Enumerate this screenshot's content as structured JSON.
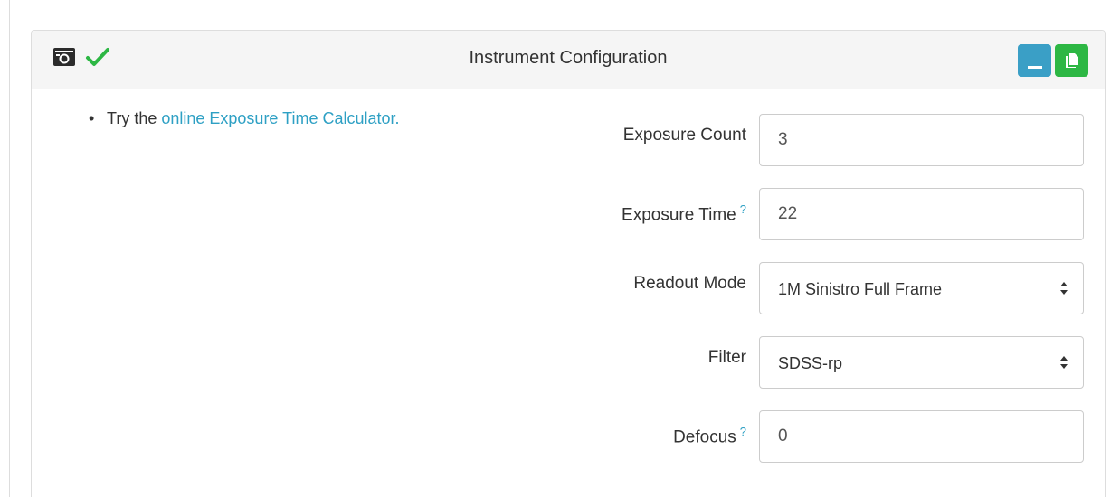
{
  "panel": {
    "title": "Instrument Configuration",
    "icons": [
      "camera-icon",
      "checkmark-icon"
    ],
    "buttons": [
      {
        "name": "minimize",
        "icon": "minimize-icon",
        "color": "#3a9fc6"
      },
      {
        "name": "copy",
        "icon": "copy-icon",
        "color": "#2db744"
      }
    ]
  },
  "tip": {
    "bullet": "•",
    "prefix": "Try the ",
    "link_text": "online Exposure Time Calculator."
  },
  "form": {
    "exposure_count": {
      "label": "Exposure Count",
      "value": "3"
    },
    "exposure_time": {
      "label": "Exposure Time",
      "help": "?",
      "value": "22"
    },
    "readout_mode": {
      "label": "Readout Mode",
      "value": "1M Sinistro Full Frame"
    },
    "filter": {
      "label": "Filter",
      "value": "SDSS-rp"
    },
    "defocus": {
      "label": "Defocus",
      "help": "?",
      "value": "0"
    }
  },
  "colors": {
    "accent_link": "#2ea0c4",
    "success_check": "#2db744",
    "minimize_button": "#3a9fc6",
    "copy_button": "#2db744",
    "heading_background": "#f5f5f5"
  }
}
